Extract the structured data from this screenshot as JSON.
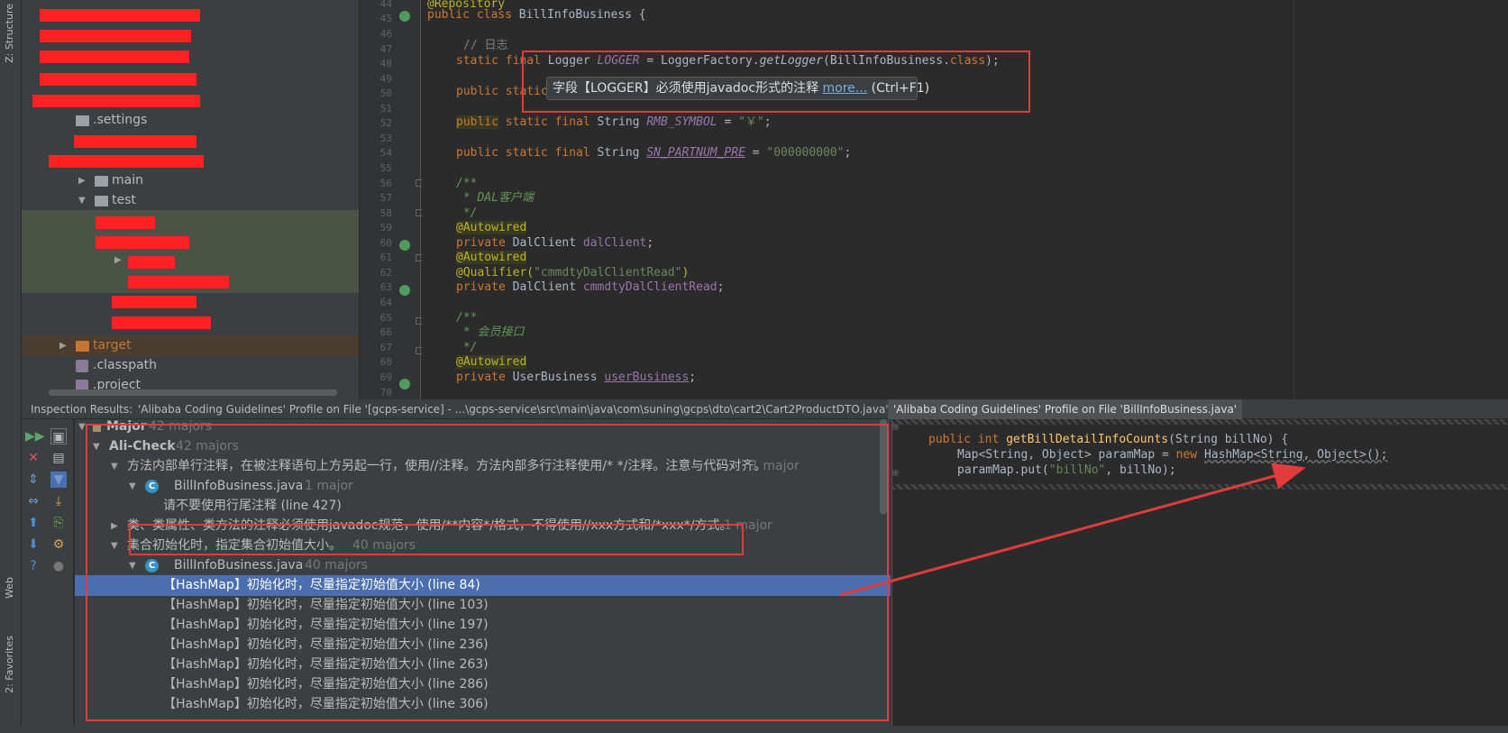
{
  "side_strip": {
    "structure": "Z: Structure",
    "web": "Web",
    "favorites": "2: Favorites"
  },
  "tree": {
    "settings": ".settings",
    "main": "main",
    "test": "test",
    "target": "target",
    "classpath": ".classpath",
    "project": ".project"
  },
  "gutter": {
    "lines": [
      "44",
      "45",
      "46",
      "47",
      "48",
      "49",
      "50",
      "51",
      "52",
      "53",
      "54",
      "55",
      "56",
      "57",
      "58",
      "59",
      "60",
      "61",
      "62",
      "63",
      "64",
      "65",
      "66",
      "67",
      "68",
      "69",
      "70"
    ]
  },
  "code": {
    "l44": "@Repository",
    "l45_kw": "public class ",
    "l45_name": "BillInfoBusiness {",
    "l47": "// 日志",
    "l48_kw": "static final ",
    "l48_type": "Logger ",
    "l48_field": "LOGGER",
    "l48_rest": " = LoggerFactory.",
    "l48_fn": "getLogger",
    "l48_rest2": "(BillInfoBusiness.",
    "l48_class": "class",
    "l48_end": ");",
    "l50_kw": "public static",
    "l52_kw1": "public",
    "l52_kw2": " static final ",
    "l52_type": "String ",
    "l52_field": "RMB_SYMBOL",
    "l52_eq": " = ",
    "l52_str": "\"￥\"",
    "l52_end": ";",
    "l54_kw": "public static final ",
    "l54_type": "String ",
    "l54_field": "SN_PARTNUM_PRE",
    "l54_eq": " = ",
    "l54_str": "\"000000000\"",
    "l54_end": ";",
    "l56": "/**",
    "l57": " * DAL客户端",
    "l58": " */",
    "l59": "@Autowired",
    "l60_kw": "private ",
    "l60_type": "DalClient ",
    "l60_field": "dalClient",
    "l60_end": ";",
    "l61": "@Autowired",
    "l62_an": "@Qualifier(",
    "l62_str": "\"cmmdtyDalClientRead\"",
    "l62_end": ")",
    "l63_kw": "private ",
    "l63_type": "DalClient ",
    "l63_field": "cmmdtyDalClientRead",
    "l63_end": ";",
    "l65": "/**",
    "l66": " * 会员接口",
    "l67": " */",
    "l68": "@Autowired",
    "l69_kw": "private ",
    "l69_type": "UserBusiness ",
    "l69_field": "userBusiness",
    "l69_end": ";"
  },
  "tooltip": {
    "text": "字段【LOGGER】必须使用javadoc形式的注释 ",
    "more": "more...",
    "shortcut": " (Ctrl+F1)"
  },
  "inspection": {
    "label": "Inspection Results:",
    "tab1": "'Alibaba Coding Guidelines' Profile on File '[gcps-service] - ...\\gcps-service\\src\\main\\java\\com\\suning\\gcps\\dto\\cart2\\Cart2ProductDTO.java'",
    "tab2": "'Alibaba Coding Guidelines' Profile on File 'BillInfoBusiness.java'"
  },
  "results": {
    "major": "Major",
    "major_count": "42 majors",
    "alicheck": "Ali-Check",
    "alicheck_count": "42 majors",
    "rule1": "方法内部单行注释，在被注释语句上方另起一行，使用//注释。方法内部多行注释使用/* */注释。注意与代码对齐。",
    "rule1_count": "1 major",
    "file1": "BillInfoBusiness.java",
    "file1_count": "1 major",
    "item1": "请不要使用行尾注释 (line 427)",
    "rule2": "类、类属性、类方法的注释必须使用javadoc规范，使用/**内容*/格式，不得使用//xxx方式和/*xxx*/方式。",
    "rule2_count": "1 major",
    "rule3": "集合初始化时，指定集合初始值大小。",
    "rule3_count": "40 majors",
    "file2": "BillInfoBusiness.java",
    "file2_count": "40 majors",
    "items": [
      "【HashMap】初始化时，尽量指定初始值大小 (line 84)",
      "【HashMap】初始化时，尽量指定初始值大小 (line 103)",
      "【HashMap】初始化时，尽量指定初始值大小 (line 197)",
      "【HashMap】初始化时，尽量指定初始值大小 (line 236)",
      "【HashMap】初始化时，尽量指定初始值大小 (line 263)",
      "【HashMap】初始化时，尽量指定初始值大小 (line 286)",
      "【HashMap】初始化时，尽量指定初始值大小 (line 306)"
    ]
  },
  "preview": {
    "p1_kw": "public int ",
    "p1_fn": "getBillDetailInfoCounts",
    "p1_rest": "(String billNo) {",
    "p2_a": "Map<String, Object> paramMap = ",
    "p2_kw": "new ",
    "p2_b": "HashMap<String, Object>();",
    "p3_a": "paramMap.put(",
    "p3_str": "\"billNo\"",
    "p3_b": ", billNo);"
  },
  "colors": {
    "highlight_box": "#e23b3b",
    "selection": "#4b6eaf",
    "accent": "#3592c4"
  }
}
